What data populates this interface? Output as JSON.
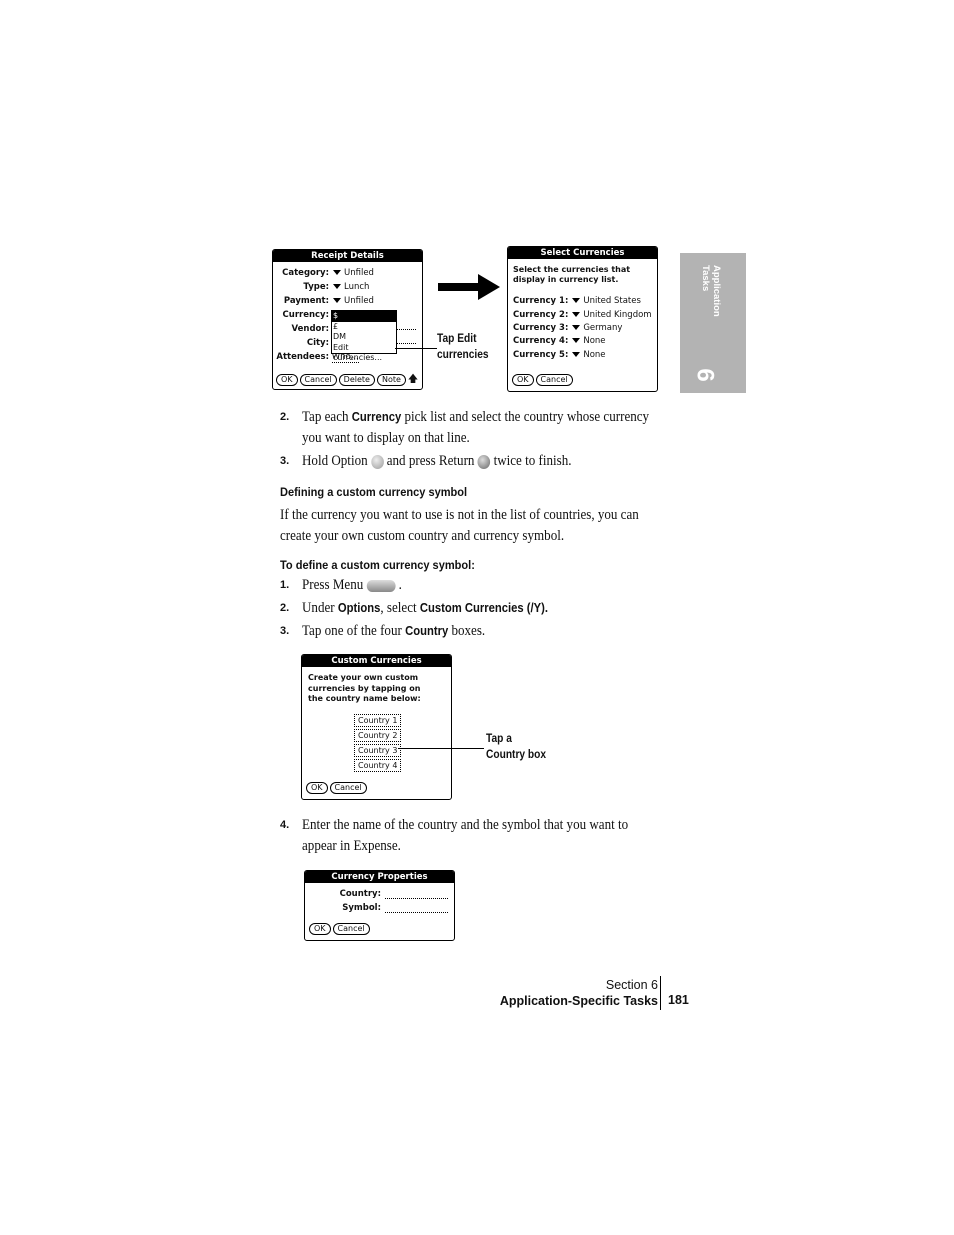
{
  "receipt_details": {
    "title": "Receipt Details",
    "rows": [
      {
        "label": "Category:",
        "value": "Unfiled"
      },
      {
        "label": "Type:",
        "value": "Lunch"
      },
      {
        "label": "Payment:",
        "value": "Unfiled"
      }
    ],
    "currency_label": "Currency:",
    "vendor_label": "Vendor:",
    "city_label": "City:",
    "attendees_label": "Attendees:",
    "attendees_value": "Who...",
    "popup": [
      "$",
      "£",
      "DM",
      "Edit currencies..."
    ],
    "buttons": [
      "OK",
      "Cancel",
      "Delete",
      "Note"
    ]
  },
  "callout_edit": [
    "Tap Edit",
    "currencies"
  ],
  "select_currencies": {
    "title": "Select Currencies",
    "intro": [
      "Select the currencies that",
      "display in currency list."
    ],
    "rows": [
      {
        "label": "Currency 1:",
        "value": "United States"
      },
      {
        "label": "Currency 2:",
        "value": "United Kingdom"
      },
      {
        "label": "Currency 3:",
        "value": "Germany"
      },
      {
        "label": "Currency 4:",
        "value": "None"
      },
      {
        "label": "Currency 5:",
        "value": "None"
      }
    ],
    "buttons": [
      "OK",
      "Cancel"
    ]
  },
  "side_tab": {
    "label1": "Application",
    "label2": "Tasks",
    "number": "6"
  },
  "steps_a": [
    {
      "num": "2.",
      "pre": "Tap each ",
      "bold": "Currency",
      "post": " pick list and select the country whose currency",
      "line2": "you want to display on that line."
    },
    {
      "num": "3.",
      "t1": "Hold Option",
      "t2": "and press Return",
      "t3": "twice to finish."
    }
  ],
  "heading1": "Defining a custom currency symbol",
  "para1": [
    "If the currency you want to use is not in the list of countries, you can",
    "create your own custom country and currency symbol."
  ],
  "heading2": "To define a custom currency symbol:",
  "steps_b": [
    {
      "num": "1.",
      "t1": "Press Menu",
      "t2": "."
    },
    {
      "num": "2.",
      "t1": "Under ",
      "b1": "Options",
      "t2": ", select ",
      "b2": "Custom Currencies (/Y)."
    },
    {
      "num": "3.",
      "t1": "Tap one of the four ",
      "b1": "Country",
      "t2": " boxes."
    }
  ],
  "custom_currencies": {
    "title": "Custom Currencies",
    "intro": [
      "Create your own custom",
      "currencies by tapping on",
      "the country name below:"
    ],
    "countries": [
      "Country 1",
      "Country 2",
      "Country 3",
      "Country 4"
    ],
    "buttons": [
      "OK",
      "Cancel"
    ]
  },
  "callout_country": [
    "Tap a",
    "Country box"
  ],
  "step4": {
    "num": "4.",
    "line1": "Enter the name of the country and the symbol that you want to",
    "line2": "appear in Expense."
  },
  "currency_properties": {
    "title": "Currency Properties",
    "country_label": "Country:",
    "symbol_label": "Symbol:",
    "buttons": [
      "OK",
      "Cancel"
    ]
  },
  "footer": {
    "section": "Section 6",
    "chapter": "Application-Specific Tasks",
    "page": "181"
  }
}
